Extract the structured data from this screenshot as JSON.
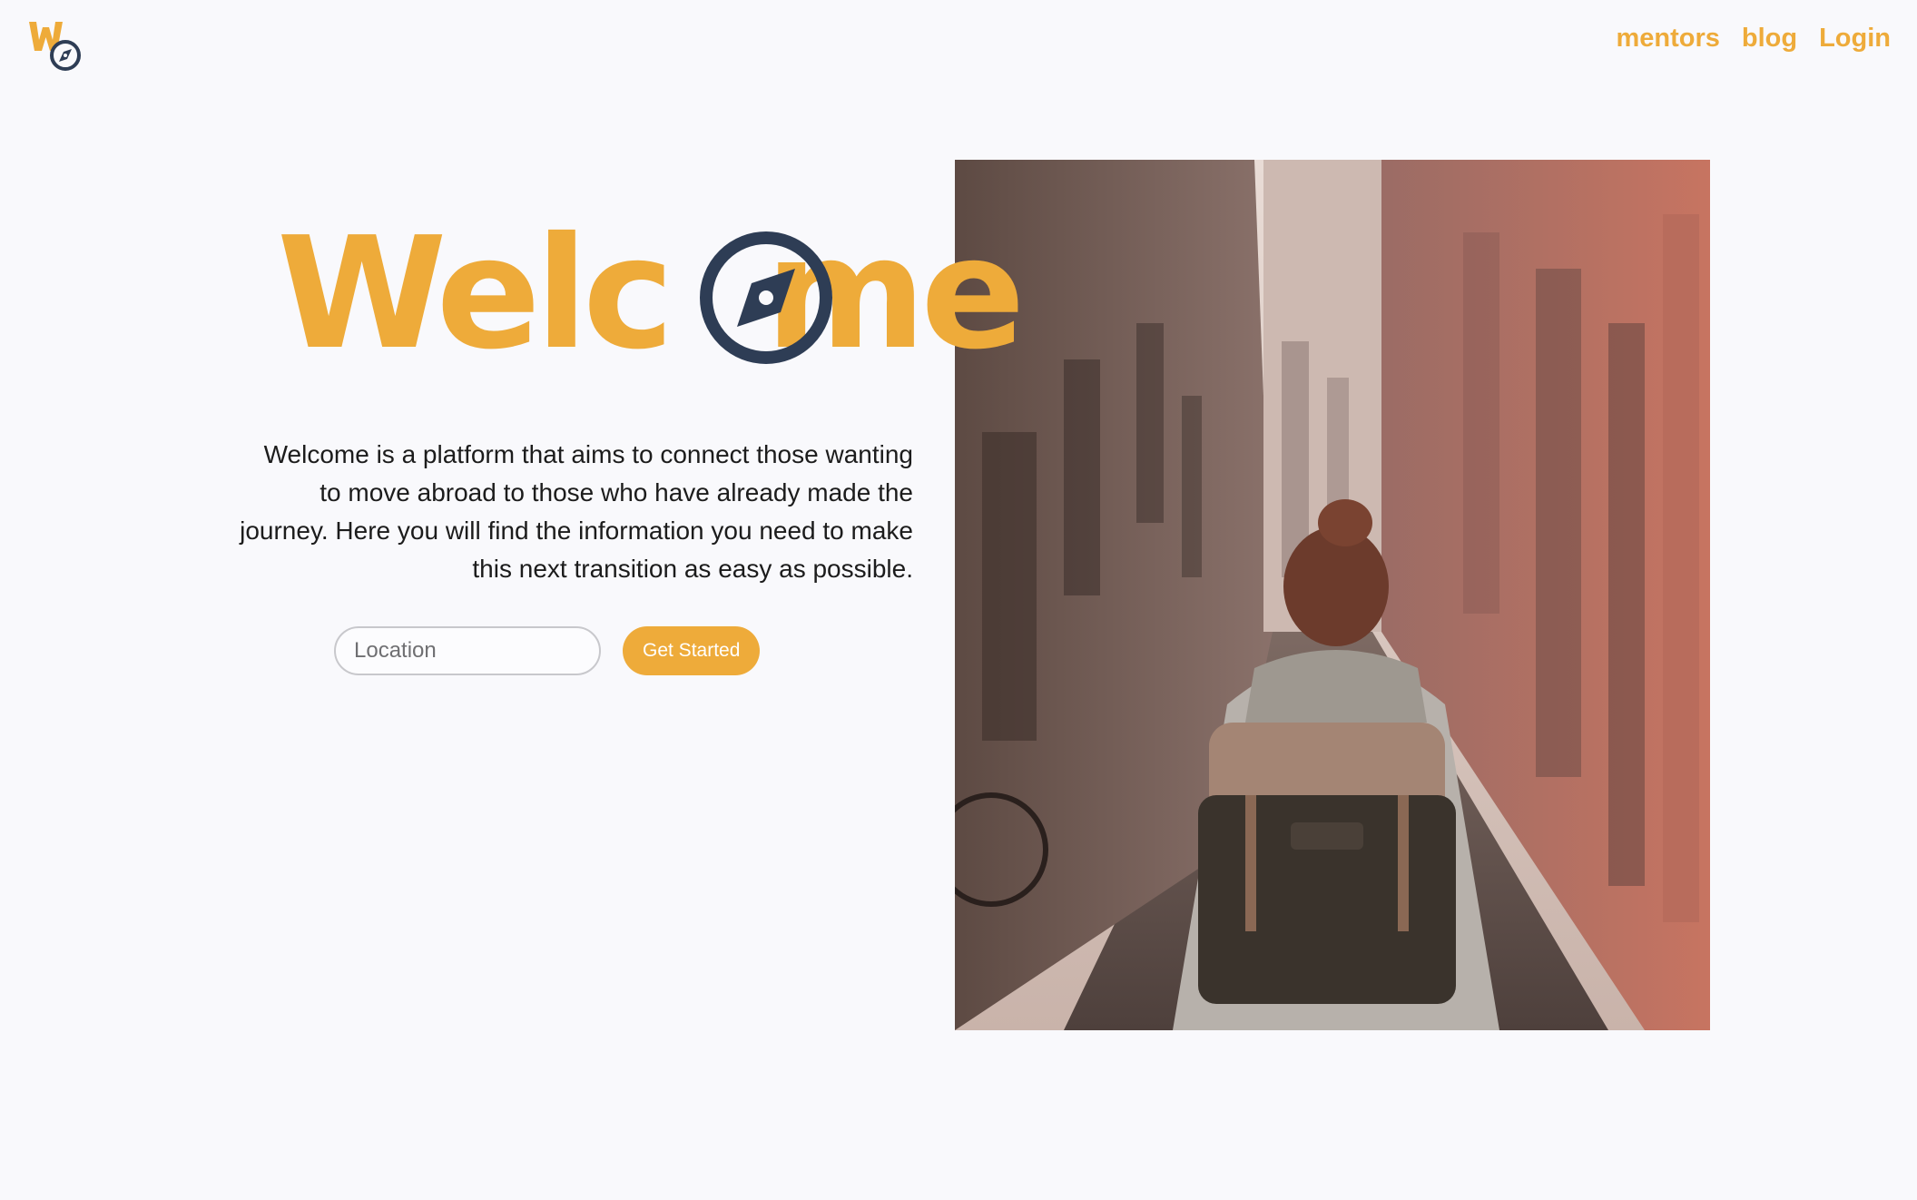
{
  "header": {
    "logo_icon": "w-compass-logo-icon",
    "nav": {
      "mentors": "mentors",
      "blog": "blog",
      "login": "Login"
    }
  },
  "hero": {
    "headline": "Welc  me",
    "headline_compass_icon": "compass-icon",
    "description": "Welcome is a platform that aims to connect those wanting to move abroad to those who have already made the journey. Here you will find the information you need to make this next transition as easy as possible.",
    "search": {
      "placeholder": "Location",
      "value": "",
      "button_label": "Get Started"
    },
    "photo": "traveler-with-backpack-in-narrow-alley"
  },
  "colors": {
    "accent": "#eeab3a",
    "dark": "#2e3d55",
    "background": "#f9f9fc"
  }
}
